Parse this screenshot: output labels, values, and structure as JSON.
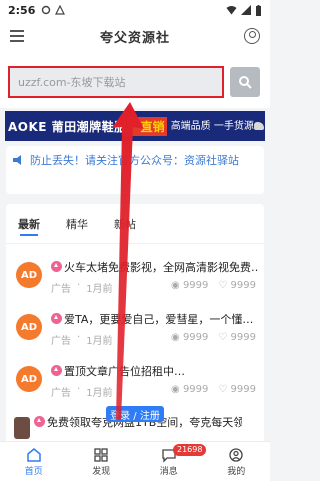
{
  "status": {
    "time": "2:56"
  },
  "header": {
    "title": "夸父资源社"
  },
  "search": {
    "placeholder": "uzzf.com-东坡下载站"
  },
  "banner": {
    "text_main": "AOKE 莆田潮牌鞋服",
    "text_highlight": "厂直销",
    "text_side": "高端品质 一手货源"
  },
  "notice": {
    "text": "防止丢失！请关注官方公众号：资源社驿站"
  },
  "tabs": [
    {
      "label": "最新"
    },
    {
      "label": "精华"
    },
    {
      "label": "新帖"
    }
  ],
  "posts": [
    {
      "avatar": "AD",
      "title": "火车太堵免费影视，全网高清影视免费…",
      "category": "广告",
      "time": "1月前",
      "views": "9999",
      "likes": "9999"
    },
    {
      "avatar": "AD",
      "title": "爱TA，更要爱自己，爱彗星，一个懂…",
      "category": "广告",
      "time": "1月前",
      "views": "9999",
      "likes": "9999"
    },
    {
      "avatar": "AD",
      "title": "置顶文章广告位招租中…",
      "category": "广告",
      "time": "1月前",
      "views": "9999",
      "likes": "9999"
    },
    {
      "avatar": "",
      "title": "免费领取夸克网盘1TB空间，夸克每天领…",
      "category": "",
      "time": "",
      "views": "",
      "likes": ""
    }
  ],
  "login": {
    "label": "登录 / 注册"
  },
  "tabbar": {
    "items": [
      {
        "label": "首页"
      },
      {
        "label": "发现"
      },
      {
        "label": "消息"
      },
      {
        "label": "我的"
      }
    ],
    "badge": "21698"
  },
  "colors": {
    "accent": "#2f7cf6",
    "highlight_border": "#e0202a",
    "arrow": "#e0202a"
  }
}
